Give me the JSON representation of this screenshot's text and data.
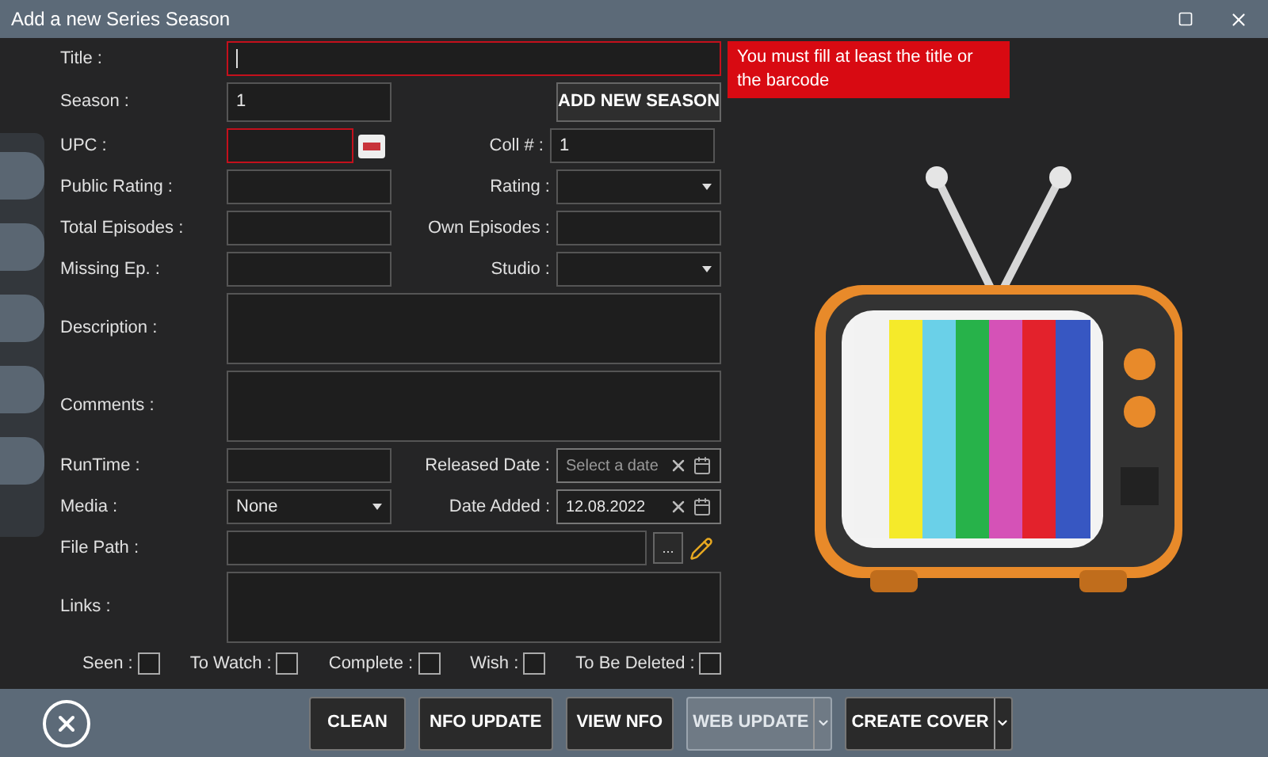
{
  "window": {
    "title": "Add a new Series Season"
  },
  "validation_message": "You must fill at least the title or the barcode",
  "rows": [
    {
      "kind": "wide",
      "label": "Title :",
      "field": {
        "kind": "text",
        "invalid": true,
        "focused": true
      }
    },
    {
      "kind": "pair",
      "left": {
        "label": "Season :",
        "field": {
          "kind": "text",
          "value": "1"
        }
      },
      "right": {
        "field": {
          "kind": "button",
          "label": "ADD NEW SEASON"
        }
      }
    },
    {
      "kind": "pair",
      "left": {
        "label": "UPC :",
        "field": {
          "kind": "text",
          "invalid": true,
          "barcode_button": true
        }
      },
      "right": {
        "label": "Coll # :",
        "field": {
          "kind": "text",
          "value": "1"
        }
      }
    },
    {
      "kind": "pair",
      "left": {
        "label": "Public Rating :",
        "field": {
          "kind": "text"
        }
      },
      "right": {
        "label": "Rating :",
        "field": {
          "kind": "select"
        }
      }
    },
    {
      "kind": "pair",
      "left": {
        "label": "Total Episodes :",
        "field": {
          "kind": "text"
        }
      },
      "right": {
        "label": "Own Episodes :",
        "field": {
          "kind": "text"
        }
      }
    },
    {
      "kind": "pair",
      "left": {
        "label": "Missing Ep. :",
        "field": {
          "kind": "text"
        }
      },
      "right": {
        "label": "Studio :",
        "field": {
          "kind": "select"
        }
      }
    },
    {
      "kind": "wide",
      "label": "Description :",
      "field": {
        "kind": "area"
      }
    },
    {
      "kind": "wide",
      "label": "Comments :",
      "field": {
        "kind": "area"
      }
    },
    {
      "kind": "pair",
      "left": {
        "label": "RunTime :",
        "field": {
          "kind": "text"
        }
      },
      "right": {
        "label": "Released Date :",
        "field": {
          "kind": "date",
          "placeholder": "Select a date"
        }
      }
    },
    {
      "kind": "pair",
      "left": {
        "label": "Media :",
        "field": {
          "kind": "select",
          "value": "None"
        }
      },
      "right": {
        "label": "Date Added :",
        "field": {
          "kind": "date",
          "value": "12.08.2022"
        }
      }
    },
    {
      "kind": "wide",
      "label": "File Path :",
      "field": {
        "kind": "path",
        "browse": "..."
      }
    },
    {
      "kind": "wide",
      "label": "Links :",
      "field": {
        "kind": "area"
      }
    }
  ],
  "checkboxes": [
    {
      "label": "Seen :",
      "checked": false
    },
    {
      "label": "To Watch :",
      "checked": false
    },
    {
      "label": "Complete :",
      "checked": false
    },
    {
      "label": "Wish :",
      "checked": false
    },
    {
      "label": "To Be Deleted :",
      "checked": false
    }
  ],
  "buttons": [
    {
      "label": "CLEAN",
      "kind": "plain",
      "disabled": false
    },
    {
      "label": "NFO UPDATE",
      "kind": "plain",
      "disabled": false
    },
    {
      "label": "VIEW NFO",
      "kind": "plain",
      "disabled": false
    },
    {
      "label": "WEB UPDATE",
      "kind": "split",
      "disabled": true
    },
    {
      "label": "CREATE COVER",
      "kind": "split",
      "disabled": false
    }
  ]
}
